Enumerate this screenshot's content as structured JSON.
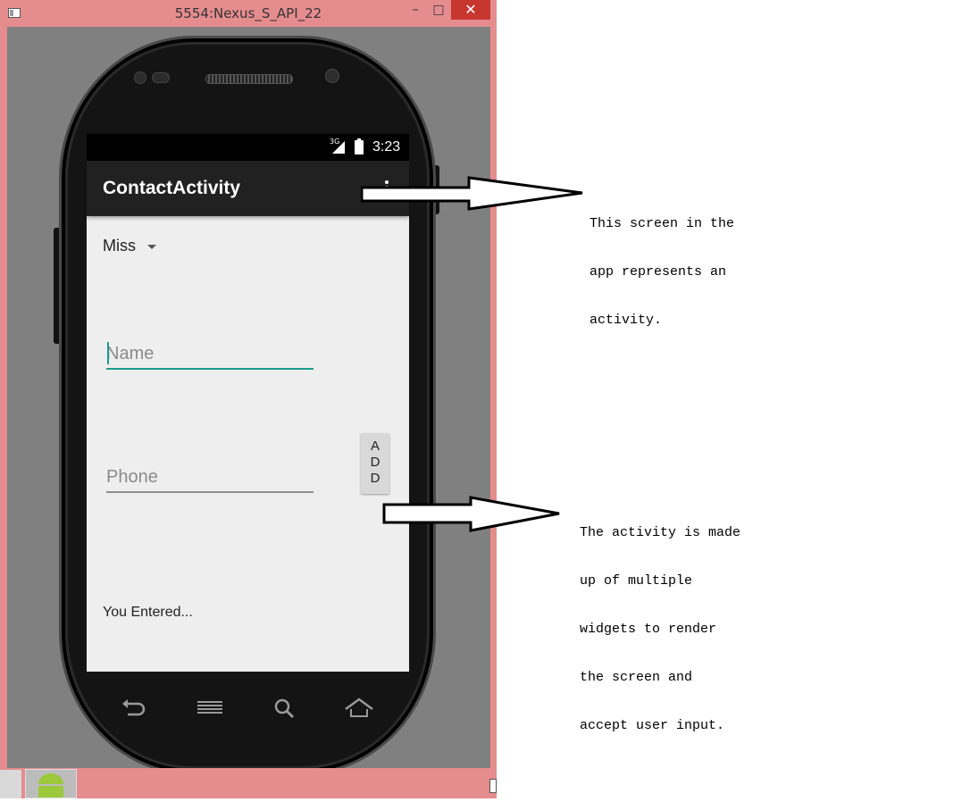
{
  "window": {
    "title": "5554:Nexus_S_API_22",
    "minimize_glyph": "–",
    "maximize_glyph": "□",
    "close_glyph": "✕"
  },
  "status_bar": {
    "network": "3G",
    "time": "3:23"
  },
  "app": {
    "title": "ContactActivity",
    "spinner_value": "Miss",
    "name_placeholder": "Name",
    "phone_placeholder": "Phone",
    "add_button": [
      "A",
      "D",
      "D"
    ],
    "result_text": "You Entered..."
  },
  "annotations": [
    {
      "lines": [
        "This screen in the",
        "app represents an",
        "activity."
      ]
    },
    {
      "lines": [
        "The activity is made",
        "up of multiple",
        "widgets to render",
        "the screen and",
        "accept user input."
      ]
    }
  ],
  "colors": {
    "accent": "#1e9b8a",
    "toolbar": "#212121",
    "window_frame": "#e58c8e"
  }
}
